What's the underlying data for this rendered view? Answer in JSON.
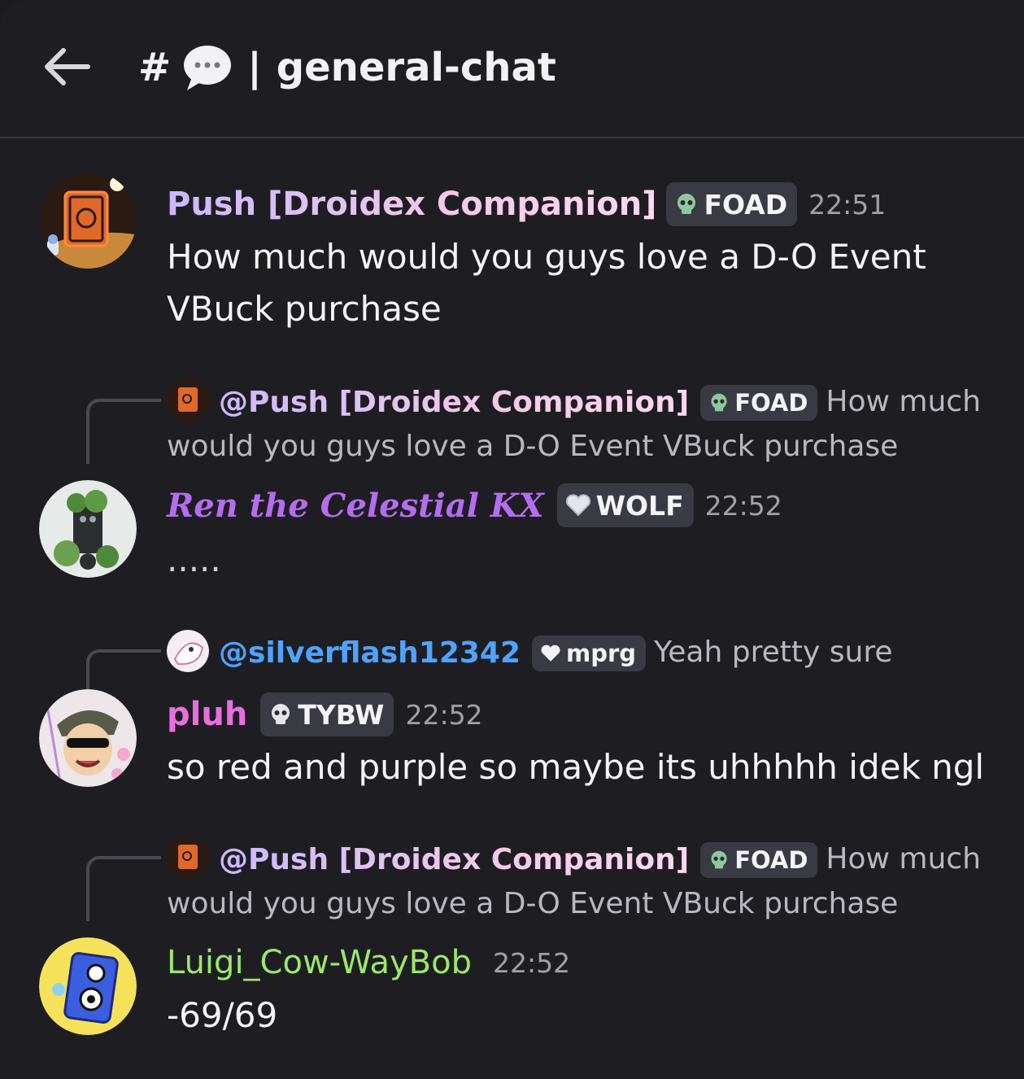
{
  "header": {
    "back_label": "back",
    "hash": "#",
    "bubble_emoji": "💬",
    "pipe": "|",
    "channel_name": "general-chat"
  },
  "messages": [
    {
      "username": "Push [Droidex Companion]",
      "name_color": "#c9b8ff",
      "tag": "FOAD",
      "tag_icon": "skull-icon",
      "time": "22:51",
      "text": "How much would you guys love a  D-O Event VBuck purchase"
    },
    {
      "reply": {
        "username": "@Push [Droidex Companion]",
        "tag": "FOAD",
        "text": "How much would you guys love a  D-O Event VBuck purchase"
      },
      "username": "Ren the Celestial KX",
      "name_color": "#b56cf0",
      "tag": "WOLF",
      "tag_icon": "heart-icon",
      "time": "22:52",
      "text": "....."
    },
    {
      "reply": {
        "username": "@silverflash12342",
        "name_color": "#4fa3ff",
        "tag": "mprg",
        "text": "Yeah pretty sure"
      },
      "username": "pluh",
      "name_color": "#e96ee0",
      "tag": "TYBW",
      "tag_icon": "skull-icon",
      "time": "22:52",
      "text": "so red and purple so maybe its uhhhhh idek ngl"
    },
    {
      "reply": {
        "username": "@Push [Droidex Companion]",
        "tag": "FOAD",
        "text": "How much would you guys love a  D-O Event VBuck purchase"
      },
      "username": "Luigi_Cow-WayBob",
      "name_color": "#9be76a",
      "time": "22:52",
      "text": "-69/69"
    }
  ],
  "colors": {
    "background": "#1e1e22",
    "tag_bg": "#3a3a42",
    "timestamp": "#a0a0a8"
  }
}
